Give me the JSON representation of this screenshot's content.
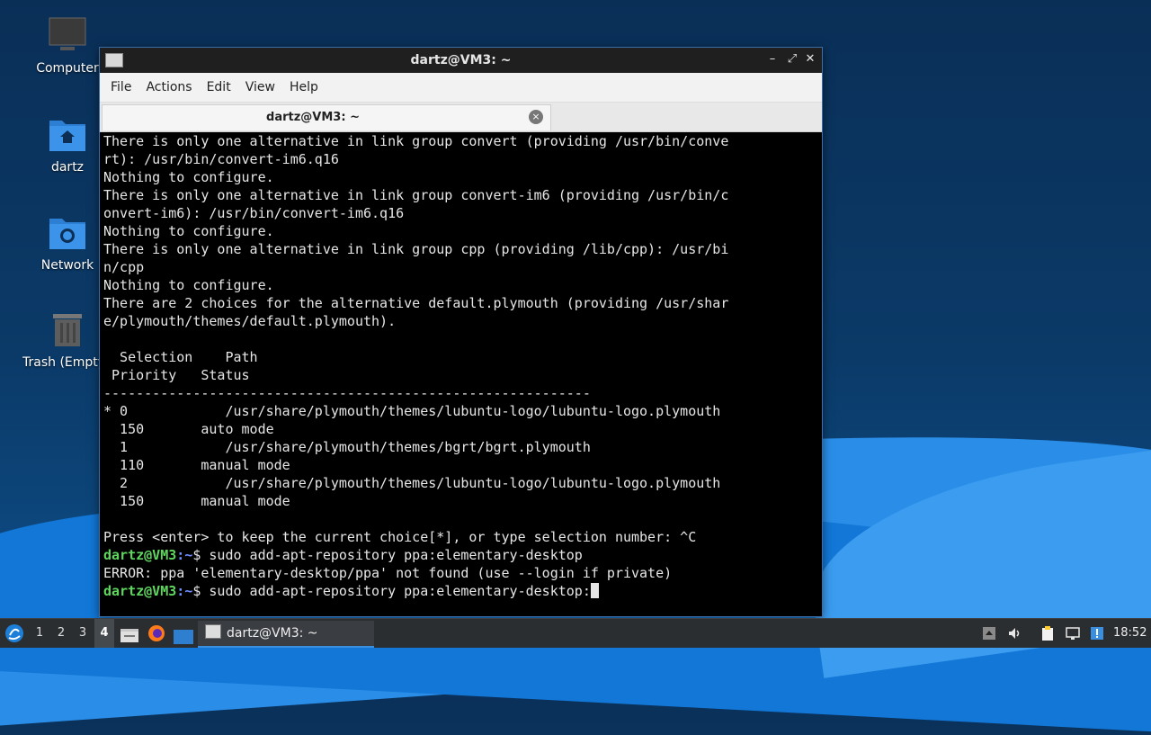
{
  "desktop": {
    "icons": [
      {
        "label": "Computer",
        "icon": "computer-icon"
      },
      {
        "label": "dartz",
        "icon": "home-folder-icon"
      },
      {
        "label": "Network",
        "icon": "network-folder-icon"
      },
      {
        "label": "Trash (Empty)",
        "icon": "trash-icon"
      }
    ]
  },
  "window": {
    "title": "dartz@VM3: ~",
    "controls": {
      "minimize": "–",
      "maximize": "⤢",
      "close": "✕"
    },
    "menu": [
      "File",
      "Actions",
      "Edit",
      "View",
      "Help"
    ],
    "tab": {
      "label": "dartz@VM3: ~",
      "close": "×"
    }
  },
  "terminal": {
    "lines": [
      "There is only one alternative in link group convert (providing /usr/bin/conve",
      "rt): /usr/bin/convert-im6.q16",
      "Nothing to configure.",
      "There is only one alternative in link group convert-im6 (providing /usr/bin/c",
      "onvert-im6): /usr/bin/convert-im6.q16",
      "Nothing to configure.",
      "There is only one alternative in link group cpp (providing /lib/cpp): /usr/bi",
      "n/cpp",
      "Nothing to configure.",
      "There are 2 choices for the alternative default.plymouth (providing /usr/shar",
      "e/plymouth/themes/default.plymouth).",
      "",
      "  Selection    Path",
      " Priority   Status",
      "------------------------------------------------------------",
      "* 0            /usr/share/plymouth/themes/lubuntu-logo/lubuntu-logo.plymouth",
      "  150       auto mode",
      "  1            /usr/share/plymouth/themes/bgrt/bgrt.plymouth",
      "  110       manual mode",
      "  2            /usr/share/plymouth/themes/lubuntu-logo/lubuntu-logo.plymouth",
      "  150       manual mode",
      "",
      "Press <enter> to keep the current choice[*], or type selection number: ^C"
    ],
    "prompt_user": "dartz@VM3",
    "prompt_path": ":~",
    "prompt_sym": "$ ",
    "cmd1": "sudo add-apt-repository ppa:elementary-desktop",
    "error": "ERROR: ppa 'elementary-desktop/ppa' not found (use --login if private)",
    "cmd2": "sudo add-apt-repository ppa:elementary-desktop:"
  },
  "taskbar": {
    "workspaces": [
      "1",
      "2",
      "3",
      "4"
    ],
    "active_workspace": "4",
    "task_label": "dartz@VM3: ~",
    "clock": "18:52"
  }
}
